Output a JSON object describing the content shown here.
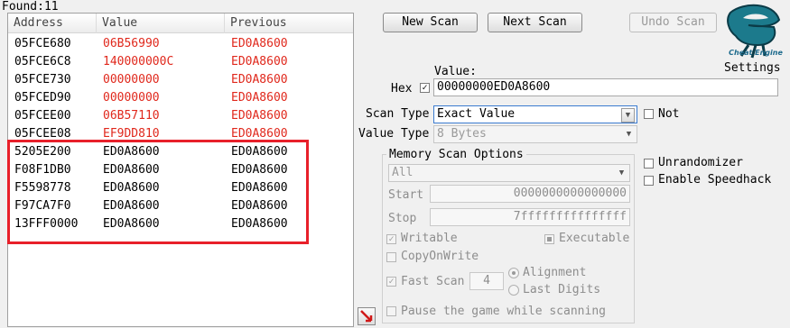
{
  "found_label": "Found:11",
  "table": {
    "columns": [
      "Address",
      "Value",
      "Previous"
    ],
    "rows": [
      {
        "address": "05FCE680",
        "value": "06B56990",
        "previous": "ED0A8600",
        "changed": true
      },
      {
        "address": "05FCE6C8",
        "value": "140000000C",
        "previous": "ED0A8600",
        "changed": true
      },
      {
        "address": "05FCE730",
        "value": "00000000",
        "previous": "ED0A8600",
        "changed": true
      },
      {
        "address": "05FCED90",
        "value": "00000000",
        "previous": "ED0A8600",
        "changed": true
      },
      {
        "address": "05FCEE00",
        "value": "06B57110",
        "previous": "ED0A8600",
        "changed": true
      },
      {
        "address": "05FCEE08",
        "value": "EF9DD810",
        "previous": "ED0A8600",
        "changed": true
      },
      {
        "address": "5205E200",
        "value": "ED0A8600",
        "previous": "ED0A8600",
        "changed": false
      },
      {
        "address": "F08F1DB0",
        "value": "ED0A8600",
        "previous": "ED0A8600",
        "changed": false
      },
      {
        "address": "F5598778",
        "value": "ED0A8600",
        "previous": "ED0A8600",
        "changed": false
      },
      {
        "address": "F97CA7F0",
        "value": "ED0A8600",
        "previous": "ED0A8600",
        "changed": false
      },
      {
        "address": "13FFF0000",
        "value": "ED0A8600",
        "previous": "ED0A8600",
        "changed": false
      }
    ]
  },
  "buttons": {
    "new_scan": "New Scan",
    "next_scan": "Next Scan",
    "undo_scan": "Undo Scan"
  },
  "logo": {
    "text": "Cheat Engine",
    "icon": "cheat-engine-logo-icon"
  },
  "settings_label": "Settings",
  "value_label": "Value:",
  "hex": {
    "label": "Hex",
    "checked": true
  },
  "value_input": "00000000ED0A8600",
  "scan_type": {
    "label": "Scan Type",
    "selected": "Exact Value"
  },
  "not": {
    "label": "Not",
    "checked": false
  },
  "value_type": {
    "label": "Value Type",
    "selected": "8 Bytes"
  },
  "memory_options": {
    "title": "Memory Scan Options",
    "region": "All",
    "start_label": "Start",
    "start_value": "0000000000000000",
    "stop_label": "Stop",
    "stop_value": "7fffffffffffffff",
    "writable": {
      "label": "Writable",
      "checked": true
    },
    "executable": {
      "label": "Executable",
      "state": "indeterminate"
    },
    "copyonwrite": {
      "label": "CopyOnWrite",
      "checked": false
    },
    "fast_scan": {
      "label": "Fast Scan",
      "checked": true,
      "value": "4"
    },
    "alignment": {
      "label": "Alignment",
      "selected": true
    },
    "last_digits": {
      "label": "Last Digits",
      "selected": false
    },
    "pause": {
      "label": "Pause the game while scanning",
      "checked": false
    }
  },
  "unrandomizer": {
    "label": "Unrandomizer",
    "checked": false
  },
  "speedhack": {
    "label": "Enable Speedhack",
    "checked": false
  },
  "colors": {
    "changed": "#e0281c",
    "highlight_box": "#e8202a"
  }
}
